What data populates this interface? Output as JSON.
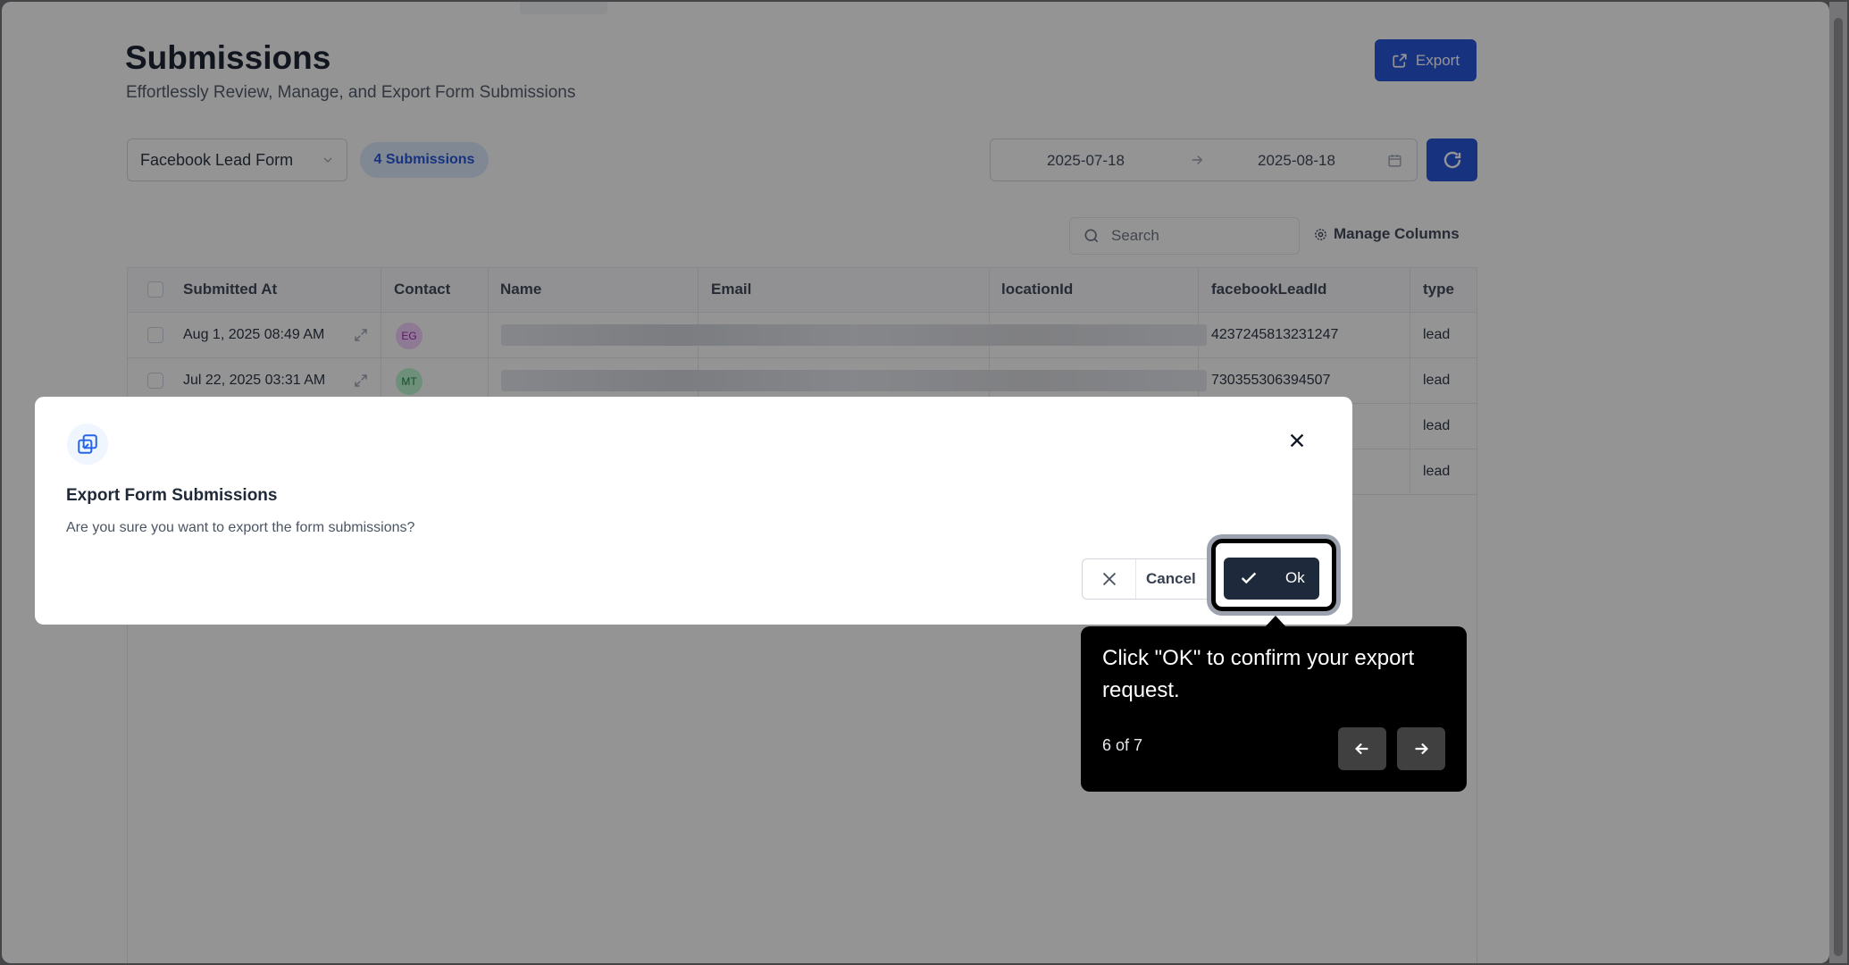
{
  "page": {
    "title": "Submissions",
    "subtitle": "Effortlessly Review, Manage, and Export Form Submissions",
    "export_label": "Export"
  },
  "filters": {
    "form_select": "Facebook Lead Form",
    "submissions_badge": "4 Submissions",
    "date_start": "2025-07-18",
    "date_end": "2025-08-18",
    "search_placeholder": "Search",
    "manage_columns_label": "Manage Columns"
  },
  "table": {
    "columns": [
      "Submitted At",
      "Contact",
      "Name",
      "Email",
      "locationId",
      "facebookLeadId",
      "type"
    ],
    "rows": [
      {
        "submitted_at": "Aug 1, 2025 08:49 AM",
        "contact_initials": "EG",
        "facebook_lead_id": "4237245813231247",
        "type": "lead"
      },
      {
        "submitted_at": "Jul 22, 2025 03:31 AM",
        "contact_initials": "MT",
        "facebook_lead_id": "730355306394507",
        "type": "lead"
      },
      {
        "type": "lead"
      },
      {
        "type": "lead"
      }
    ]
  },
  "modal": {
    "title": "Export Form Submissions",
    "message": "Are you sure you want to export the form submissions?",
    "cancel_label": "Cancel",
    "ok_label": "Ok"
  },
  "tour": {
    "text": "Click \"OK\" to confirm your export request.",
    "step": "6 of 7"
  },
  "colors": {
    "primary": "#1d4ed8",
    "badge_bg": "#dbeafe",
    "ok_button": "#1e293b",
    "tooltip_bg": "#000000",
    "avatar_eg": "#c026d3",
    "avatar_mt": "#16a34a"
  },
  "icons": [
    "export-icon",
    "chevron-down-icon",
    "arrow-right-icon",
    "calendar-icon",
    "refresh-icon",
    "search-icon",
    "gear-icon",
    "expand-icon",
    "copy-icon",
    "close-icon",
    "check-icon",
    "arrow-left-icon"
  ]
}
